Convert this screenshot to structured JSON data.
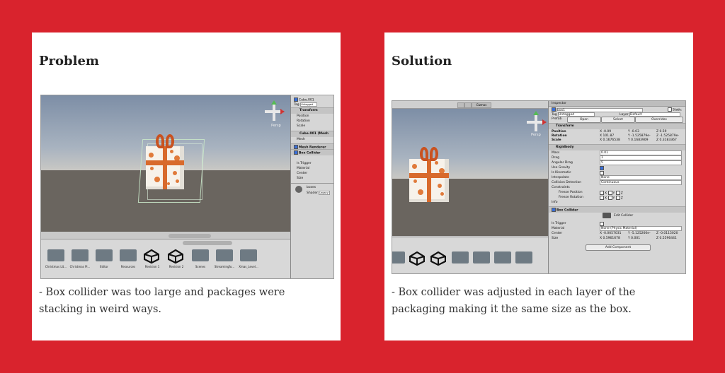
{
  "problem": {
    "title": "Problem",
    "caption": "- Box collider was too large and packages were stacking in weird ways.",
    "inspector": {
      "object_name": "Cube.001",
      "tag_label": "Tag",
      "tag_value": "Untagged",
      "transform": "Transform",
      "position": "Position",
      "rotation": "Rotation",
      "scale": "Scale",
      "mesh_filter": "Cube.001 (Mesh",
      "mesh_label": "Mesh",
      "mesh_renderer": "Mesh Renderer",
      "box_collider": "Box Collider",
      "is_trigger": "Is Trigger",
      "material": "Material",
      "center": "Center",
      "size": "Size",
      "material_name": "boxes",
      "shader_label": "Shader",
      "shader_value": "Legacy"
    },
    "persp_label": "Persp",
    "folders": [
      "Christmas Lit...",
      "Christmas Pi...",
      "Editor",
      "Resources",
      "Revision 1",
      "Revision 2",
      "Scenes",
      "Streamingfo...",
      "Xmas_Level..."
    ]
  },
  "solution": {
    "title": "Solution",
    "caption": "- Box collider was adjusted in each layer of the packaging making it the same size as the box.",
    "toolbar_gizmos": "Gizmos",
    "inspector": {
      "header": "Inspector",
      "object_name": "box1",
      "static_label": "Static",
      "tag_label": "Tag",
      "tag_value": "Untagged",
      "layer_label": "Layer",
      "layer_value": "Default",
      "prefab_label": "Prefab",
      "prefab_open": "Open",
      "prefab_select": "Select",
      "prefab_overrides": "Overrides",
      "transform": "Transform",
      "position": "Position",
      "rotation": "Rotation",
      "scale": "Scale",
      "pos_x": "X -0.09",
      "pos_y": "Y -0.03",
      "pos_z": "Z 0.59",
      "rot_x": "X 101.87",
      "rot_y": "Y -1.525879e-",
      "rot_z": "Z -1.525879e-",
      "scale_x": "X 0.1676538",
      "scale_y": "Y 0.1683909",
      "scale_z": "Z 0.3183367",
      "rigidbody": "Rigidbody",
      "mass": "Mass",
      "mass_value": "0.01",
      "drag": "Drag",
      "drag_value": "1",
      "angular_drag": "Angular Drag",
      "angular_drag_value": "5",
      "use_gravity": "Use Gravity",
      "is_kinematic": "Is Kinematic",
      "interpolate": "Interpolate",
      "interpolate_value": "None",
      "collision_detection": "Collision Detection",
      "collision_detection_value": "Continuous",
      "constraints": "Constraints",
      "freeze_position": "Freeze Position",
      "freeze_rotation": "Freeze Rotation",
      "info": "Info",
      "box_collider": "Box Collider",
      "edit_collider": "Edit Collider",
      "is_trigger": "Is Trigger",
      "material": "Material",
      "material_value": "None (Physic Material)",
      "center": "Center",
      "center_x": "X -0.0057031",
      "center_y": "Y -5.125266e-",
      "center_z": "Z -0.0115020",
      "size": "Size",
      "size_x": "X 0.5961678",
      "size_y": "Y 0.001",
      "size_z": "Z 0.5596441",
      "add_component": "Add Component"
    },
    "persp_label": "Persp"
  }
}
